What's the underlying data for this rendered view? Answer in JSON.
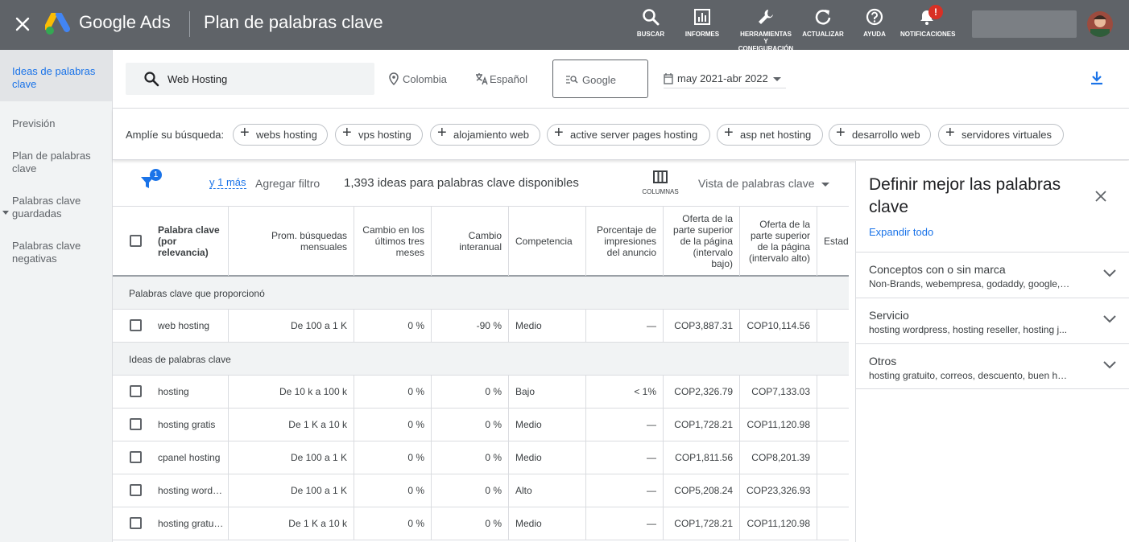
{
  "topbar": {
    "brand": "Google Ads",
    "page_title": "Plan de palabras clave",
    "buttons": [
      {
        "label": "BUSCAR",
        "icon": "search-icon"
      },
      {
        "label": "INFORMES",
        "icon": "bar-chart-icon"
      },
      {
        "label": "HERRAMIENTAS Y CONFIGURACIÓN",
        "icon": "wrench-icon"
      },
      {
        "label": "ACTUALIZAR",
        "icon": "refresh-icon"
      },
      {
        "label": "AYUDA",
        "icon": "help-icon"
      },
      {
        "label": "NOTIFICACIONES",
        "icon": "bell-icon"
      }
    ],
    "notification_badge": "!"
  },
  "sidenav": {
    "items": [
      {
        "label": "Ideas de palabras clave",
        "active": true
      },
      {
        "label": "Previsión",
        "active": false
      },
      {
        "label": "Plan de palabras clave",
        "active": false
      },
      {
        "label": "Palabras clave guardadas",
        "active": false
      },
      {
        "label": "Palabras clave negativas",
        "active": false
      }
    ]
  },
  "search": {
    "value": "Web Hosting",
    "location": "Colombia",
    "language": "Español",
    "network": "Google",
    "date_range": "may 2021-abr 2022"
  },
  "broaden": {
    "label": "Amplíe su búsqueda:",
    "chips": [
      "webs hosting",
      "vps hosting",
      "alojamiento web",
      "active server pages hosting",
      "asp net hosting",
      "desarrollo web",
      "servidores virtuales"
    ]
  },
  "toolbar": {
    "filter_count": "1",
    "more_link": "y 1 más",
    "add_filter": "Agregar filtro",
    "ideas_count": "1,393 ideas para palabras clave disponibles",
    "columns_label": "COLUMNAS",
    "view_label": "Vista de palabras clave"
  },
  "table": {
    "headers": [
      "Palabra clave (por relevancia)",
      "Prom. búsquedas mensuales",
      "Cambio en los últimos tres meses",
      "Cambio interanual",
      "Competencia",
      "Porcentaje de impresiones del anuncio",
      "Oferta de la parte superior de la página (intervalo bajo)",
      "Oferta de la parte superior de la página (intervalo alto)",
      "Estad"
    ],
    "section_provided": "Palabras clave que proporcionó",
    "section_ideas": "Ideas de palabras clave",
    "provided_rows": [
      [
        "web hosting",
        "De 100 a 1 K",
        "0 %",
        "-90 %",
        "Medio",
        "—",
        "COP3,887.31",
        "COP10,114.56"
      ]
    ],
    "idea_rows": [
      [
        "hosting",
        "De 10 k a 100 k",
        "0 %",
        "0 %",
        "Bajo",
        "< 1%",
        "COP2,326.79",
        "COP7,133.03"
      ],
      [
        "hosting gratis",
        "De 1 K a 10 k",
        "0 %",
        "0 %",
        "Medio",
        "—",
        "COP1,728.21",
        "COP11,120.98"
      ],
      [
        "cpanel hosting",
        "De 100 a 1 K",
        "0 %",
        "0 %",
        "Medio",
        "—",
        "COP1,811.56",
        "COP8,201.39"
      ],
      [
        "hosting word…",
        "De 100 a 1 K",
        "0 %",
        "0 %",
        "Alto",
        "—",
        "COP5,208.24",
        "COP23,326.93"
      ],
      [
        "hosting gratu…",
        "De 1 K a 10 k",
        "0 %",
        "0 %",
        "Medio",
        "—",
        "COP1,728.21",
        "COP11,120.98"
      ]
    ]
  },
  "panel": {
    "title": "Definir mejor las palabras clave",
    "expand_all": "Expandir todo",
    "groups": [
      {
        "title": "Conceptos con o sin marca",
        "subtitle": "Non-Brands, webempresa, godaddy, google, ..."
      },
      {
        "title": "Servicio",
        "subtitle": "hosting wordpress, hosting reseller, hosting j..."
      },
      {
        "title": "Otros",
        "subtitle": "hosting gratuito, correos, descuento, buen ho..."
      }
    ]
  }
}
